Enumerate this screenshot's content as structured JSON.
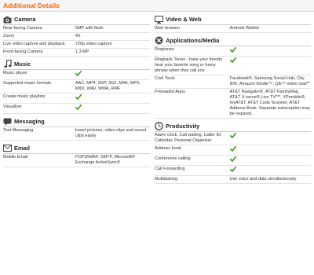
{
  "header": {
    "title": "Additional Details"
  },
  "colors": {
    "accent": "#ff6600",
    "check": "#3a9a1a"
  },
  "left": [
    {
      "title": "Camera",
      "icon": "camera-icon",
      "rows": [
        {
          "label": "Rear-facing Camera",
          "value": "5MP with flash"
        },
        {
          "label": "Zoom",
          "value": "4X"
        },
        {
          "label": "Live video capture and playback",
          "value": "720p video capture"
        },
        {
          "label": "Front-facing Camera",
          "value": "1.3 MP"
        }
      ]
    },
    {
      "title": "Music",
      "icon": "music-note-icon",
      "rows": [
        {
          "label": "Music player",
          "check": true
        },
        {
          "label": "Supported music formats",
          "value": "AAC, MP4, 3GP, 3G2, M4A, MP3, MIDI, WAV, WMA, RMF"
        },
        {
          "label": "Create music playlists",
          "check": true
        },
        {
          "label": "Visualizer",
          "check": true
        }
      ]
    },
    {
      "title": "Messaging",
      "icon": "speech-bubble-icon",
      "rows": [
        {
          "label": "Text Messaging",
          "value": "Insert pictures, video clips and sound clips easily"
        }
      ]
    },
    {
      "title": "Email",
      "icon": "envelope-icon",
      "rows": [
        {
          "label": "Mobile Email",
          "value": "POP3/IMAP, SMTP, Microsoft® Exchange ActiveSync®"
        }
      ]
    }
  ],
  "right": [
    {
      "title": "Video & Web",
      "icon": "monitor-icon",
      "rows": [
        {
          "label": "Web browser",
          "value": "Android Webkit"
        }
      ]
    },
    {
      "title": "Applications/Media",
      "icon": "applications-icon",
      "rows": [
        {
          "label": "Ringtones",
          "check": true
        },
        {
          "label": "Ringback Tones - have your friends hear your favorite song or funny phrase when they call you",
          "check": true
        },
        {
          "label": "Cool Tools",
          "value": "Facebook®, Samsung Social Hub, City ID®, Amazon Kindle™, Qik™ video chat**"
        },
        {
          "label": "Preloaded Apps",
          "value": "AT&T Navigator®, AT&T FamilyMap, AT&T U-verse® Live TV***, YPmobile®, myAT&T, AT&T Code Scanner, AT&T Address Book. Separate subscription may be required."
        }
      ]
    },
    {
      "title": "Productivity",
      "icon": "clock-icon",
      "rows": [
        {
          "label": "Alarm clock, Call waiting, Caller ID, Calendar, Personal Organizer",
          "check": true
        },
        {
          "label": "Address book",
          "check": true
        },
        {
          "label": "Conference calling",
          "check": true
        },
        {
          "label": "Call Forwarding",
          "check": true
        },
        {
          "label": "Multitasking",
          "value": "Use voice and data simultaneously"
        }
      ]
    }
  ]
}
